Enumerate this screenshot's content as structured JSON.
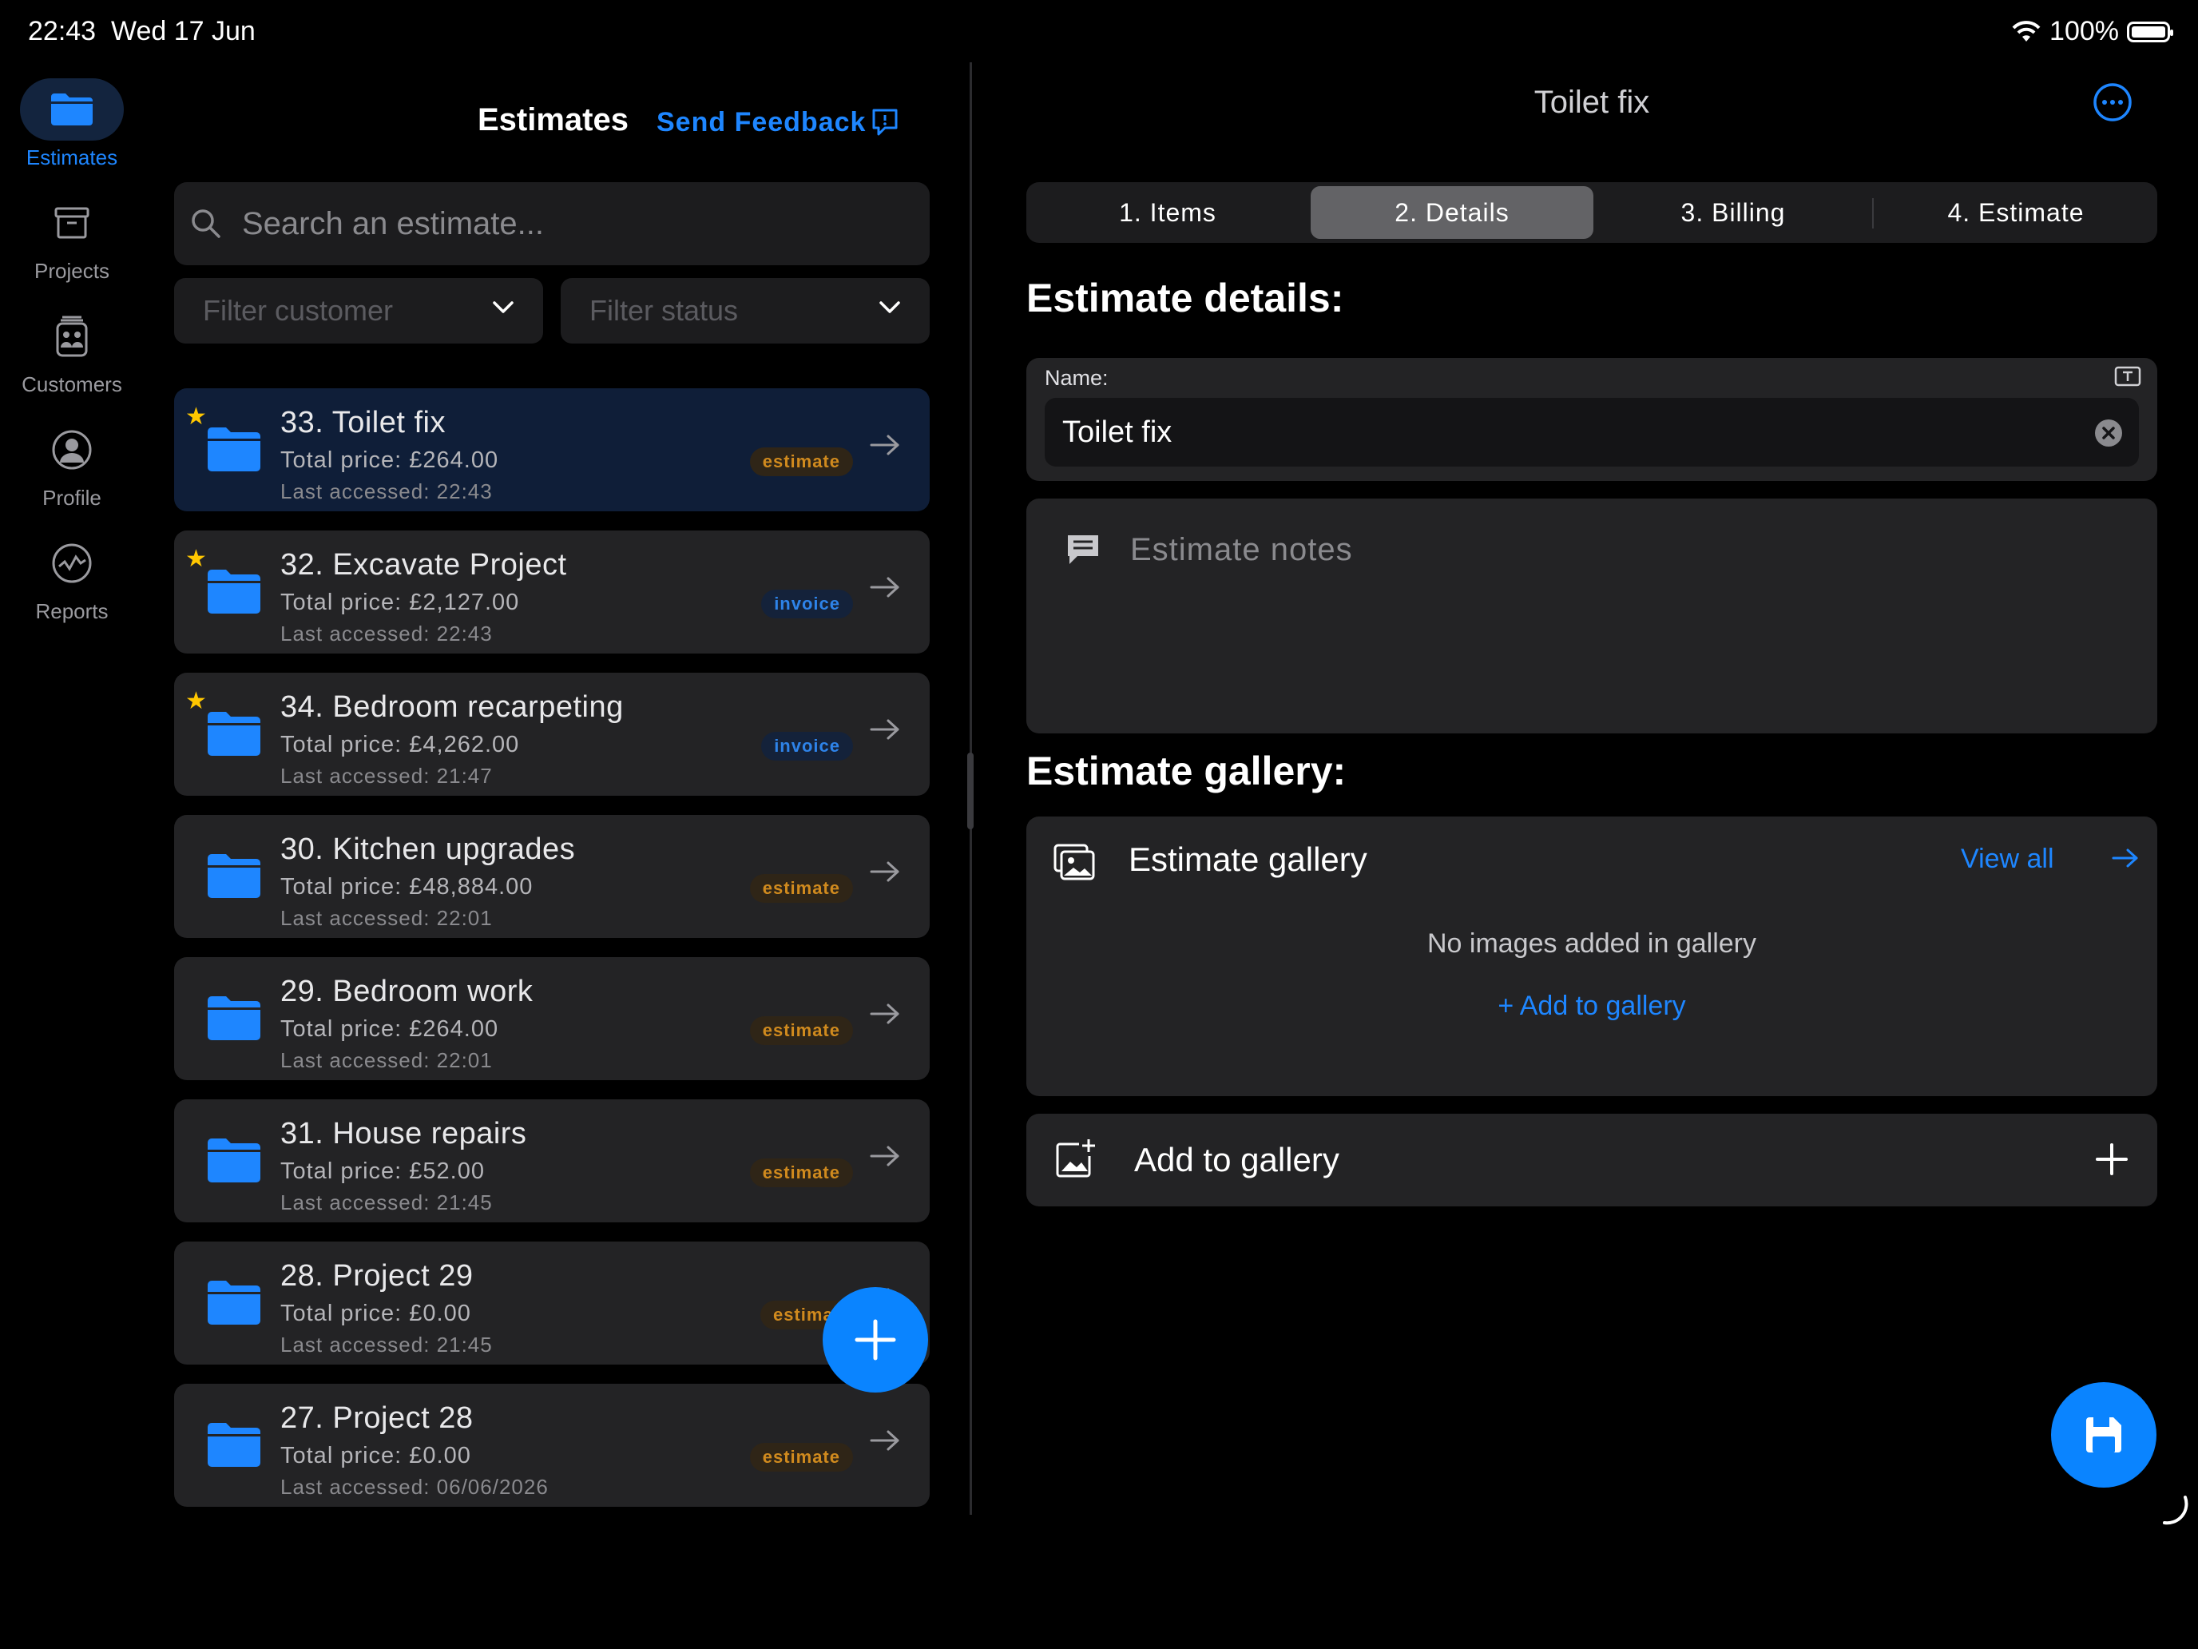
{
  "status_bar": {
    "time": "22:43",
    "date": "Wed 17 Jun",
    "battery": "100%"
  },
  "sidebar": {
    "items": [
      {
        "label": "Estimates",
        "icon": "folder-icon",
        "active": true
      },
      {
        "label": "Projects",
        "icon": "archive-box-icon"
      },
      {
        "label": "Customers",
        "icon": "people-icon"
      },
      {
        "label": "Profile",
        "icon": "person-circle-icon"
      },
      {
        "label": "Reports",
        "icon": "chart-circle-icon"
      }
    ]
  },
  "list": {
    "title": "Estimates",
    "feedback_label": "Send Feedback",
    "search_placeholder": "Search an estimate...",
    "filter_customer": "Filter customer",
    "filter_status": "Filter status",
    "estimates": [
      {
        "title": "33. Toilet fix",
        "price": "Total price: £264.00",
        "accessed": "Last accessed: 22:43",
        "badge": "estimate",
        "starred": true,
        "selected": true
      },
      {
        "title": "32. Excavate Project",
        "price": "Total price: £2,127.00",
        "accessed": "Last accessed: 22:43",
        "badge": "invoice",
        "starred": true
      },
      {
        "title": "34. Bedroom recarpeting",
        "price": "Total price: £4,262.00",
        "accessed": "Last accessed: 21:47",
        "badge": "invoice",
        "starred": true
      },
      {
        "title": "30. Kitchen upgrades",
        "price": "Total price: £48,884.00",
        "accessed": "Last accessed: 22:01",
        "badge": "estimate",
        "starred": false
      },
      {
        "title": "29. Bedroom work",
        "price": "Total price: £264.00",
        "accessed": "Last accessed: 22:01",
        "badge": "estimate",
        "starred": false
      },
      {
        "title": "31. House repairs",
        "price": "Total price: £52.00",
        "accessed": "Last accessed: 21:45",
        "badge": "estimate",
        "starred": false
      },
      {
        "title": "28. Project 29",
        "price": "Total price: £0.00",
        "accessed": "Last accessed: 21:45",
        "badge": "estimat",
        "starred": false
      },
      {
        "title": "27. Project 28",
        "price": "Total price: £0.00",
        "accessed": "Last accessed: 06/06/2026",
        "badge": "estimate",
        "starred": false
      }
    ]
  },
  "detail": {
    "title": "Toilet fix",
    "tabs": [
      "1. Items",
      "2. Details",
      "3. Billing",
      "4. Estimate"
    ],
    "active_tab": "2. Details",
    "details_heading": "Estimate details:",
    "name_label": "Name:",
    "name_value": "Toilet fix",
    "notes_placeholder": "Estimate notes",
    "gallery_heading": "Estimate gallery:",
    "gallery_title": "Estimate gallery",
    "view_all": "View all",
    "gallery_empty": "No images added in gallery",
    "gallery_add_link": "+ Add to gallery",
    "add_gallery_label": "Add to gallery"
  },
  "colors": {
    "accent": "#0a84ff",
    "estimate_badge": "#d08a1e",
    "invoice_badge": "#2e83e8",
    "star": "#ffc700"
  }
}
